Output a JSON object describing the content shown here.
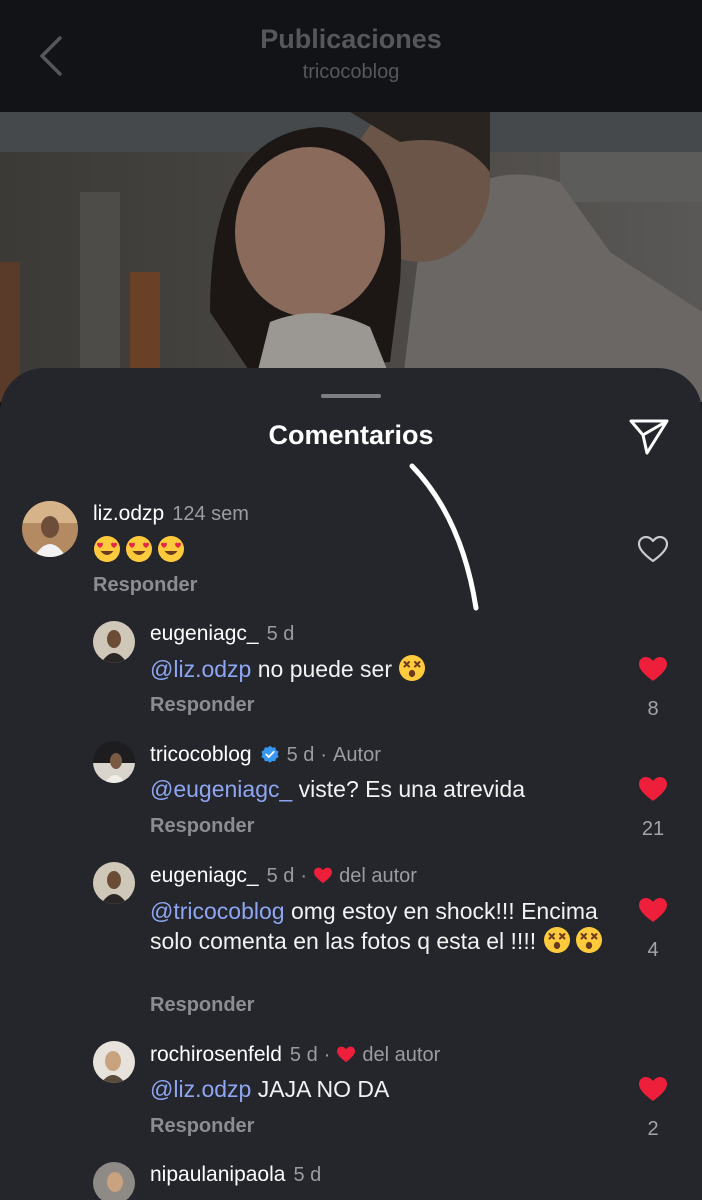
{
  "header": {
    "title": "Publicaciones",
    "subtitle": "tricocoblog"
  },
  "sheet": {
    "title": "Comentarios"
  },
  "comments": [
    {
      "user": "liz.odzp",
      "time": "124 sem",
      "emojis": [
        "heart-eyes-emoji",
        "heart-eyes-emoji",
        "heart-eyes-emoji"
      ],
      "reply": "Responder",
      "liked": false
    },
    {
      "user": "eugeniagc_",
      "time": "5 d",
      "mention": "@liz.odzp",
      "text": " no puede ser",
      "emojis": [
        "dizzy-face-emoji"
      ],
      "reply": "Responder",
      "liked": true,
      "likes": "8"
    },
    {
      "user": "tricocoblog",
      "time": "5 d",
      "tag": "Autor",
      "verified": true,
      "mention": "@eugeniagc_",
      "text": " viste? Es una atrevida",
      "reply": "Responder",
      "liked": true,
      "likes": "21"
    },
    {
      "user": "eugeniagc_",
      "time": "5 d",
      "tag": "del autor",
      "mention": "@tricocoblog",
      "text": " omg estoy en shock!!! Encima solo comenta en las fotos q esta el !!!! ",
      "emojis": [
        "dizzy-face-emoji",
        "dizzy-face-emoji"
      ],
      "reply": "Responder",
      "liked": true,
      "likes": "4"
    },
    {
      "user": "rochirosenfeld",
      "time": "5 d",
      "tag": "del autor",
      "mention": "@liz.odzp",
      "text": " JAJA NO DA",
      "reply": "Responder",
      "liked": true,
      "likes": "2"
    },
    {
      "user": "nipaulanipaola",
      "time": "5 d"
    }
  ],
  "colors": {
    "like_red": "#ee1f3b",
    "mention_blue": "#8ea6f2",
    "verified_blue": "#3897f0"
  }
}
